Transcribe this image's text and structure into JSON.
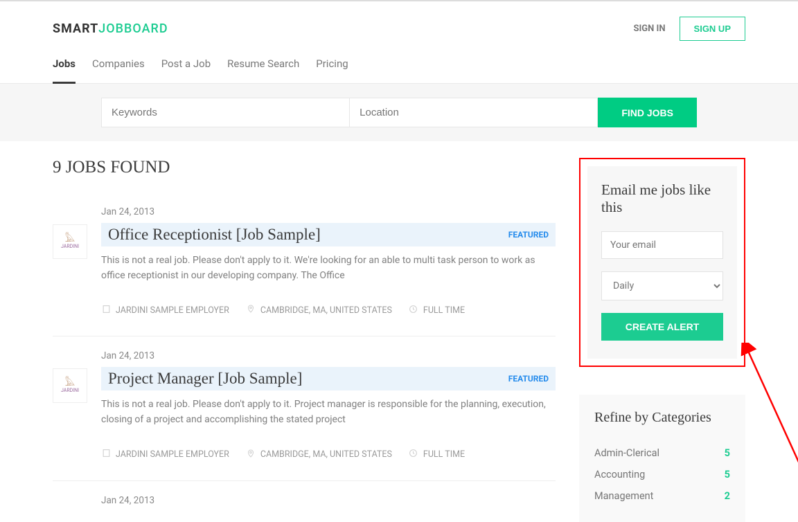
{
  "logo": {
    "part1": "SMART",
    "part2": "JOBBOARD"
  },
  "auth": {
    "signin": "SIGN IN",
    "signup": "SIGN UP"
  },
  "nav": [
    "Jobs",
    "Companies",
    "Post a Job",
    "Resume Search",
    "Pricing"
  ],
  "search": {
    "keywords_placeholder": "Keywords",
    "location_placeholder": "Location",
    "button": "FIND JOBS"
  },
  "heading": "9 JOBS FOUND",
  "jobs": [
    {
      "date": "Jan 24, 2013",
      "title": "Office Receptionist [Job Sample]",
      "badge": "FEATURED",
      "desc": "This is not a real job. Please don't apply to it. We're looking for an able to multi task person to work as office receptionist in our developing company. The Office",
      "employer": "JARDINI SAMPLE EMPLOYER",
      "location": "CAMBRIDGE, MA, UNITED STATES",
      "type": "FULL TIME",
      "logo_text": "JARDINI"
    },
    {
      "date": "Jan 24, 2013",
      "title": "Project Manager [Job Sample]",
      "badge": "FEATURED",
      "desc": "This is not a real job. Please don't apply to it. Project manager is responsible for the planning, execution, closing of a project and accomplishing the stated project",
      "employer": "JARDINI SAMPLE EMPLOYER",
      "location": "CAMBRIDGE, MA, UNITED STATES",
      "type": "FULL TIME",
      "logo_text": "JARDINI"
    },
    {
      "date": "Jan 24, 2013",
      "title": "",
      "badge": "",
      "desc": "",
      "employer": "",
      "location": "",
      "type": "",
      "logo_text": ""
    }
  ],
  "alert": {
    "heading": "Email me jobs like this",
    "email_placeholder": "Your email",
    "freq_selected": "Daily",
    "button": "CREATE ALERT"
  },
  "refine": {
    "heading": "Refine by Categories",
    "items": [
      {
        "label": "Admin-Clerical",
        "count": "5"
      },
      {
        "label": "Accounting",
        "count": "5"
      },
      {
        "label": "Management",
        "count": "2"
      }
    ]
  }
}
